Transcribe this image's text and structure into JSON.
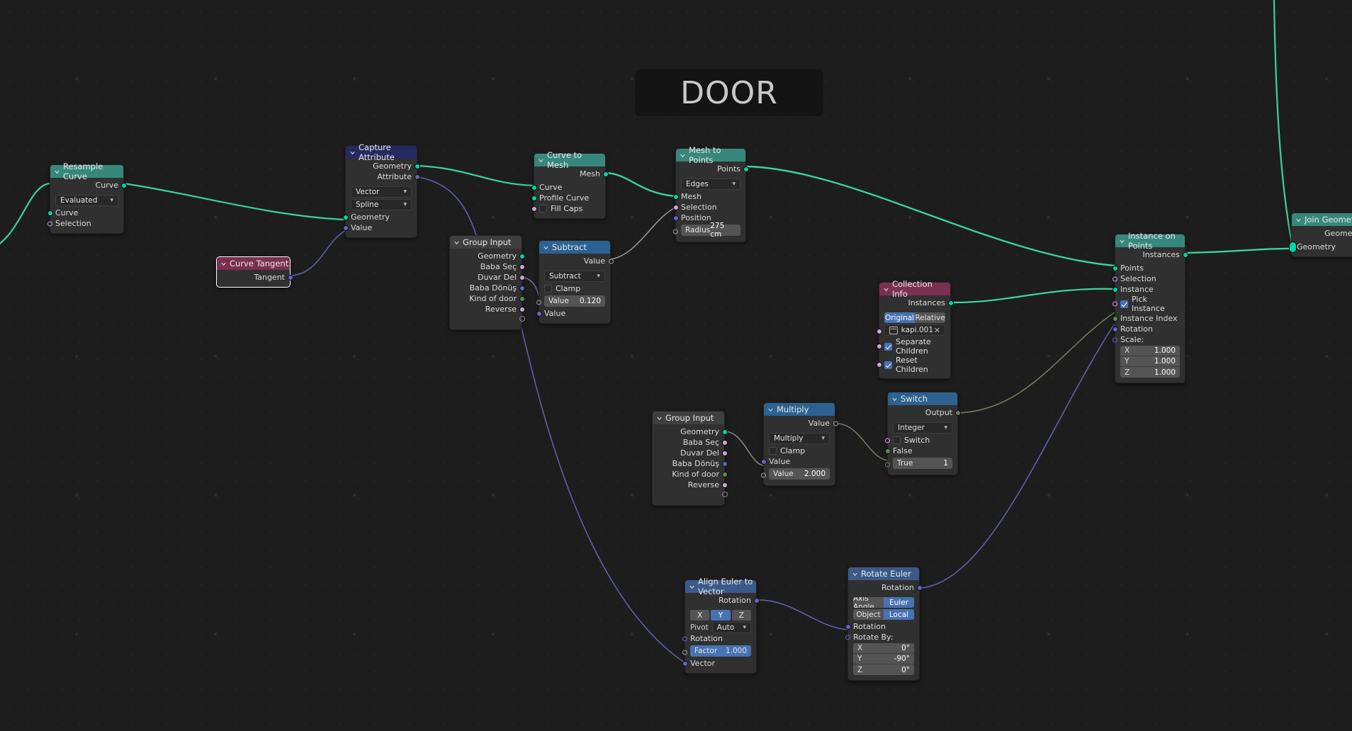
{
  "app": {
    "editor": "Blender Geometry Node Editor"
  },
  "frame": {
    "label": "DOOR"
  },
  "theme": {
    "background": "#1d1d1d",
    "node_body": "#303030",
    "header_geometry": "#37887a",
    "header_attribute": "#252a60",
    "header_input": "#3f3f3f",
    "header_converter": "#2b6290",
    "header_vector": "#3b5a8a",
    "header_red": "#7a3050",
    "accent_blue": "#4772b3",
    "wire_geometry": "#3ad39b",
    "wire_vector": "#5a5ab0",
    "wire_float": "#6e7a5e"
  },
  "nodes": {
    "resample_curve": {
      "title": "Resample Curve",
      "outputs": [
        "Curve"
      ],
      "mode": "Evaluated",
      "inputs": [
        "Curve",
        "Selection"
      ]
    },
    "curve_tangent": {
      "title": "Curve Tangent",
      "outputs": [
        "Tangent"
      ]
    },
    "capture_attribute": {
      "title": "Capture Attribute",
      "outputs": [
        "Geometry",
        "Attribute"
      ],
      "data_type": "Vector",
      "domain": "Spline",
      "inputs": [
        "Geometry",
        "Value"
      ]
    },
    "curve_to_mesh": {
      "title": "Curve to Mesh",
      "outputs": [
        "Mesh"
      ],
      "inputs": [
        "Curve",
        "Profile Curve"
      ],
      "fill_caps_label": "Fill Caps",
      "fill_caps_checked": false
    },
    "mesh_to_points": {
      "title": "Mesh to Points",
      "outputs": [
        "Points"
      ],
      "mode": "Edges",
      "inputs": [
        "Mesh",
        "Selection",
        "Position"
      ],
      "radius_label": "Radius",
      "radius_value": "275 cm"
    },
    "group_input_top": {
      "title": "Group Input",
      "outputs": [
        "Geometry",
        "Baba Seç",
        "Duvar Del",
        "Baba Dönüş",
        "Kind of door",
        "Reverse"
      ]
    },
    "subtract": {
      "title": "Subtract",
      "outputs": [
        "Value"
      ],
      "operation": "Subtract",
      "clamp_label": "Clamp",
      "clamp_checked": false,
      "value_label": "Value",
      "value_number": "0.120",
      "input_label": "Value"
    },
    "collection_info": {
      "title": "Collection Info",
      "outputs": [
        "Instances"
      ],
      "transform_original": "Original",
      "transform_relative": "Relative",
      "transform_selected": "Original",
      "collection_name": "kapi.001",
      "separate_children_label": "Separate Children",
      "separate_children_checked": true,
      "reset_children_label": "Reset Children",
      "reset_children_checked": true
    },
    "instance_on_points": {
      "title": "Instance on Points",
      "outputs": [
        "Instances"
      ],
      "inputs": [
        "Points",
        "Selection",
        "Instance"
      ],
      "pick_instance_label": "Pick Instance",
      "pick_instance_checked": true,
      "inputs_after": [
        "Instance Index",
        "Rotation"
      ],
      "scale_label": "Scale:",
      "scale": [
        {
          "axis": "X",
          "value": "1.000"
        },
        {
          "axis": "Y",
          "value": "1.000"
        },
        {
          "axis": "Z",
          "value": "1.000"
        }
      ]
    },
    "join_geometry": {
      "title": "Join Geometry",
      "outputs": [
        "Geometry"
      ],
      "inputs": [
        "Geometry"
      ]
    },
    "group_input_mid": {
      "title": "Group Input",
      "outputs": [
        "Geometry",
        "Baba Seç",
        "Duvar Del",
        "Baba Dönüş",
        "Kind of door",
        "Reverse"
      ]
    },
    "multiply": {
      "title": "Multiply",
      "outputs": [
        "Value"
      ],
      "operation": "Multiply",
      "clamp_label": "Clamp",
      "clamp_checked": false,
      "input_label": "Value",
      "value_label": "Value",
      "value_number": "2.000"
    },
    "switch": {
      "title": "Switch",
      "outputs": [
        "Output"
      ],
      "input_type": "Integer",
      "switch_label": "Switch",
      "switch_checked": false,
      "false_label": "False",
      "true_label": "True",
      "true_value": "1"
    },
    "align_euler": {
      "title": "Align Euler to Vector",
      "outputs": [
        "Rotation"
      ],
      "axes": [
        "X",
        "Y",
        "Z"
      ],
      "axis_selected": "Y",
      "pivot_label": "Pivot",
      "pivot_value": "Auto",
      "inputs": [
        "Rotation"
      ],
      "factor_label": "Factor",
      "factor_value": "1.000",
      "vector_label": "Vector"
    },
    "rotate_euler": {
      "title": "Rotate Euler",
      "outputs": [
        "Rotation"
      ],
      "type_axis_angle": "Axis Angle",
      "type_euler": "Euler",
      "type_selected": "Euler",
      "space_object": "Object",
      "space_local": "Local",
      "space_selected": "Local",
      "inputs": [
        "Rotation"
      ],
      "rotate_by_label": "Rotate By:",
      "rotate_by": [
        {
          "axis": "X",
          "value": "0°"
        },
        {
          "axis": "Y",
          "value": "-90°"
        },
        {
          "axis": "Z",
          "value": "0°"
        }
      ]
    }
  }
}
